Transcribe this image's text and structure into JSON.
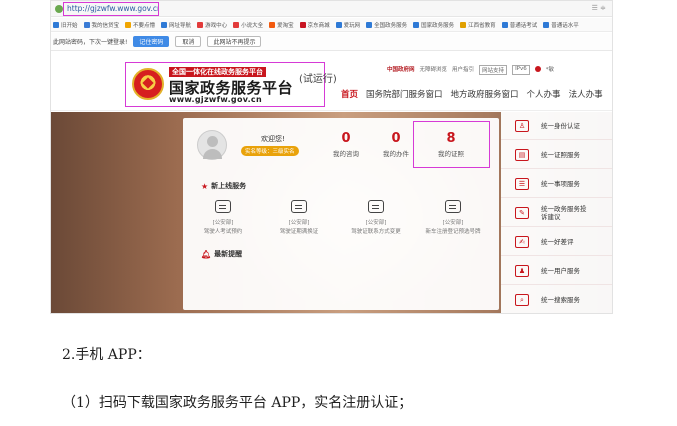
{
  "browser": {
    "url": "http://gjzwfw.www.gov.cn/",
    "controls": "☰ ≑",
    "bookmarks": [
      {
        "label": "旧开始",
        "color": "#2f7ad6"
      },
      {
        "label": "我的信贷宝",
        "color": "#3a7bd5"
      },
      {
        "label": "不要点懵",
        "color": "#f0a500"
      },
      {
        "label": "网址导航",
        "color": "#2f7ad6"
      },
      {
        "label": "游戏中心",
        "color": "#e23b3b"
      },
      {
        "label": "小说大全",
        "color": "#e23b3b"
      },
      {
        "label": "爱淘宝",
        "color": "#f25a0f"
      },
      {
        "label": "京东商城",
        "color": "#c81623"
      },
      {
        "label": "爱玩网",
        "color": "#2f7ad6"
      },
      {
        "label": "全国政务服务",
        "color": "#2f7ad6"
      },
      {
        "label": "国家政务服务",
        "color": "#2f7ad6"
      },
      {
        "label": "江西省教育",
        "color": "#e0a000"
      },
      {
        "label": "普通话考试",
        "color": "#2f7ad6"
      },
      {
        "label": "普通话水平",
        "color": "#2f7ad6"
      }
    ],
    "password_prompt": {
      "text": "此网站密码，下次一键登录!",
      "save_label": "记住密码",
      "cancel_label": "取消",
      "never_label": "此网站不再提示"
    }
  },
  "site": {
    "logo_red": "全国一体化在线政务服务平台",
    "logo_main": "国家政务服务平台",
    "logo_url": "www.gjzwfw.gov.cn",
    "trial": "(试运行)",
    "top_links": [
      "中国政府网",
      "无障碍浏览",
      "用户指引",
      "网站支持",
      "IPv6",
      "*敏"
    ],
    "nav": {
      "home": "首页",
      "items": [
        "国务院部门服务窗口",
        "地方政府服务窗口",
        "个人办事",
        "法人办事"
      ]
    }
  },
  "panel": {
    "welcome": "欢迎您!",
    "level": "实名等级：三级实名",
    "stats": [
      {
        "num": "0",
        "label": "我的咨询"
      },
      {
        "num": "0",
        "label": "我的办件"
      },
      {
        "num": "8",
        "label": "我的证照"
      }
    ],
    "new_services_title": "新上线服务",
    "services": [
      {
        "line1": "[公安部]",
        "line2": "驾驶人考试预约"
      },
      {
        "line1": "[公安部]",
        "line2": "驾驶证期满换证"
      },
      {
        "line1": "[公安部]",
        "line2": "驾驶证联系方式变更"
      },
      {
        "line1": "[公安部]",
        "line2": "新车注册登记预选号牌"
      }
    ],
    "hot_title": "最新提醒"
  },
  "sidebar": [
    {
      "label": "统一身份认证",
      "icon": "user-icon",
      "glyph": "♙"
    },
    {
      "label": "统一证照服务",
      "icon": "id-card-icon",
      "glyph": "▤"
    },
    {
      "label": "统一事项服务",
      "icon": "list-icon",
      "glyph": "☰"
    },
    {
      "label": "统一政务服务投诉建议",
      "icon": "complaint-icon",
      "glyph": "✎"
    },
    {
      "label": "统一好差评",
      "icon": "review-icon",
      "glyph": "✍"
    },
    {
      "label": "统一用户服务",
      "icon": "users-icon",
      "glyph": "♟"
    },
    {
      "label": "统一搜索服务",
      "icon": "search-icon",
      "glyph": "⌕"
    }
  ],
  "document": {
    "line1": "2.手机 APP：",
    "line2": "（1）扫码下载国家政务服务平台 APP，实名注册认证；"
  }
}
